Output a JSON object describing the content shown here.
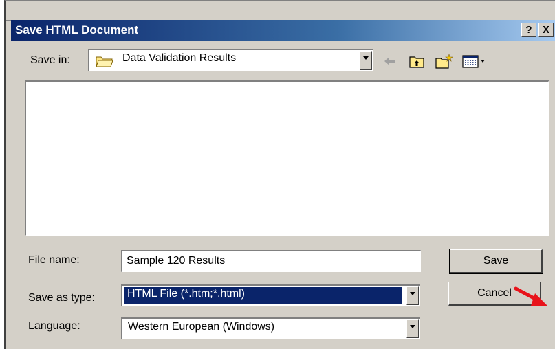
{
  "dialog": {
    "title": "Save HTML Document",
    "help_button": "?",
    "close_button": "X"
  },
  "save_in": {
    "label": "Save in:",
    "value": "Data Validation Results"
  },
  "toolbar": {
    "icons": [
      "back-arrow-icon",
      "up-one-level-icon",
      "new-folder-icon",
      "views-menu-icon"
    ]
  },
  "file_name": {
    "label": "File name:",
    "value": "Sample 120 Results"
  },
  "save_as_type": {
    "label": "Save as type:",
    "value": "HTML File (*.htm;*.html)"
  },
  "language": {
    "label": "Language:",
    "value": "Western European (Windows)"
  },
  "buttons": {
    "save": "Save",
    "cancel": "Cancel"
  },
  "colors": {
    "title_bar": "#0a246a",
    "dialog_bg": "#d4d0c8",
    "selection": "#0a246a",
    "annotation_arrow": "#e8131b"
  }
}
